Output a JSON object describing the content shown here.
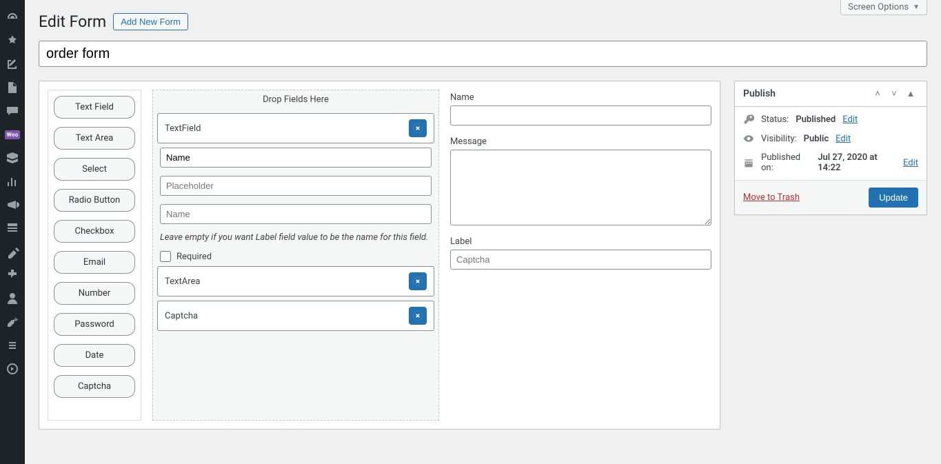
{
  "screen_options": "Screen Options",
  "page_title": "Edit Form",
  "add_new_label": "Add New Form",
  "form_title": "order form",
  "palette": [
    "Text Field",
    "Text Area",
    "Select",
    "Radio Button",
    "Checkbox",
    "Email",
    "Number",
    "Password",
    "Date",
    "Captcha"
  ],
  "dropzone_title": "Drop Fields Here",
  "block_textfield": "TextField",
  "block_textarea": "TextArea",
  "block_captcha": "Captcha",
  "config": {
    "label_value": "Name",
    "placeholder_placeholder": "Placeholder",
    "name_placeholder": "Name",
    "hint": "Leave empty if you want Label field value to be the name for this field.",
    "required_label": "Required"
  },
  "preview": {
    "name_label": "Name",
    "message_label": "Message",
    "captcha_label": "Label",
    "captcha_placeholder": "Captcha"
  },
  "publish": {
    "title": "Publish",
    "status_label": "Status:",
    "status_value": "Published",
    "visibility_label": "Visibility:",
    "visibility_value": "Public",
    "published_label": "Published on:",
    "published_value": "Jul 27, 2020 at 14:22",
    "edit": "Edit",
    "trash": "Move to Trash",
    "update": "Update"
  }
}
